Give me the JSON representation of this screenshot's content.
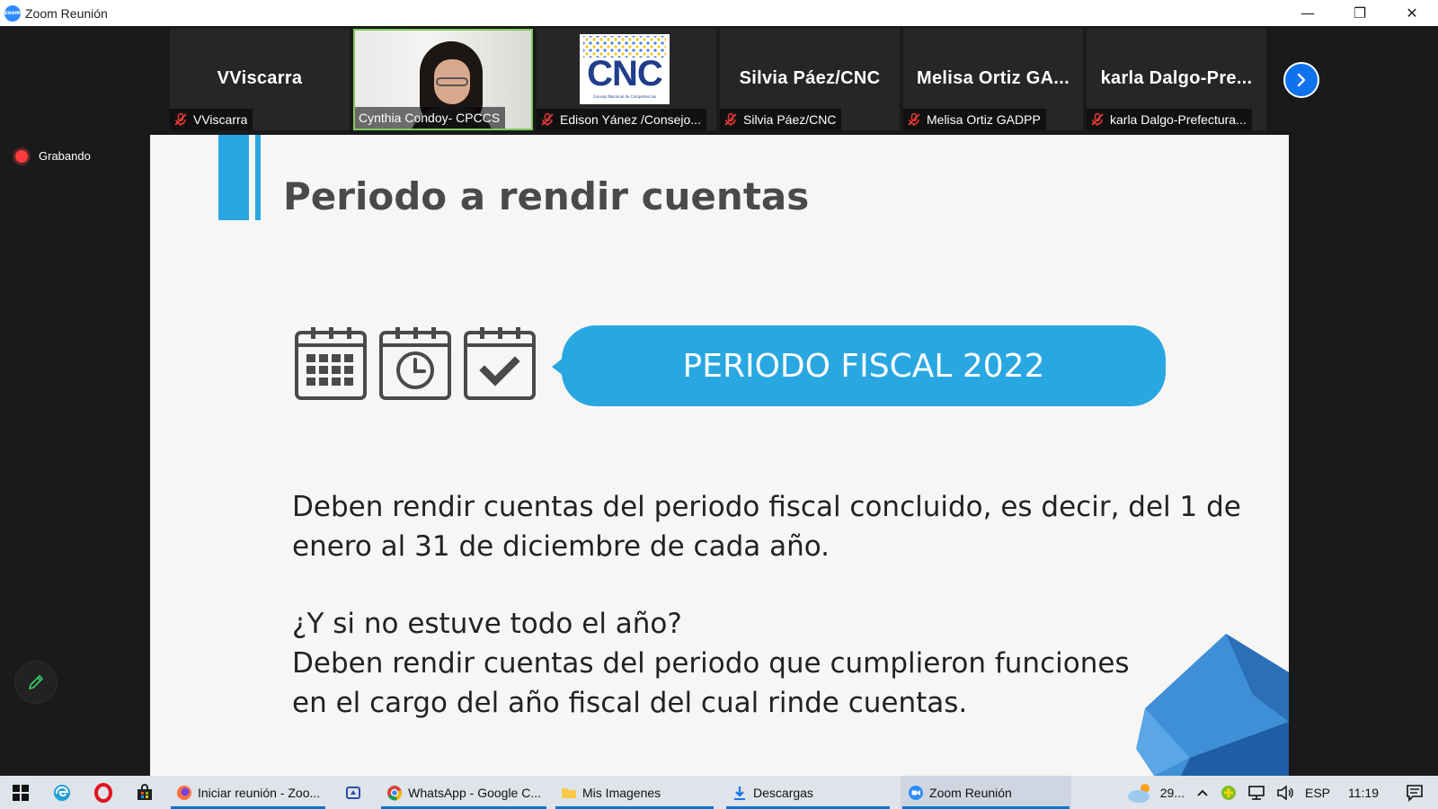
{
  "window": {
    "title": "Zoom Reunión",
    "minimize": "—",
    "maximize": "❐",
    "close": "✕"
  },
  "participants": [
    {
      "display": "VViscarra",
      "label": "VViscarra",
      "muted": true,
      "video": "none"
    },
    {
      "display": "",
      "label": "Cynthia Condoy- CPCCS",
      "muted": false,
      "video": "camera",
      "active": true
    },
    {
      "display": "",
      "label": "Edison Yánez /Consejo...",
      "muted": true,
      "video": "logo",
      "logo_text": "CNC",
      "logo_sub": "Consejo Nacional de Competencias"
    },
    {
      "display": "Silvia Páez/CNC",
      "label": "Silvia Páez/CNC",
      "muted": true,
      "video": "none"
    },
    {
      "display": "Melisa  Ortiz  GA...",
      "label": "Melisa Ortiz GADPP",
      "muted": true,
      "video": "none"
    },
    {
      "display": "karla  Dalgo-Pre...",
      "label": "karla Dalgo-Prefectura...",
      "muted": true,
      "video": "none"
    }
  ],
  "recording": {
    "label": "Grabando"
  },
  "slide": {
    "title": "Periodo a rendir cuentas",
    "badge": "PERIODO FISCAL 2022",
    "paragraph1_line1": "Deben rendir cuentas del periodo fiscal concluido, es decir, del 1 de",
    "paragraph1_line2": "enero al 31 de diciembre de cada año.",
    "question": "¿Y si no estuve todo el año?",
    "answer_line1": "Deben rendir cuentas del periodo que cumplieron funciones",
    "answer_line2": "en el cargo del año fiscal del cual rinde cuentas."
  },
  "taskbar": {
    "apps": [
      {
        "label": "Iniciar reunión - Zoo...",
        "icon": "firefox-icon",
        "open": true
      },
      {
        "label": "",
        "icon": "app-icon",
        "open": false
      },
      {
        "label": "WhatsApp - Google C...",
        "icon": "chrome-icon",
        "open": true
      },
      {
        "label": "Mis Imagenes",
        "icon": "folder-icon",
        "open": true
      },
      {
        "label": "Descargas",
        "icon": "download-folder-icon",
        "open": true
      },
      {
        "label": "Zoom Reunión",
        "icon": "zoom-icon",
        "open": true,
        "focused": true
      }
    ],
    "weather": "29...",
    "language": "ESP",
    "time": "11:19"
  },
  "colors": {
    "accent": "#29a7e1",
    "zoom_blue": "#0e72ed",
    "active_border": "#7dc95e",
    "recording": "#ff3b3b"
  }
}
